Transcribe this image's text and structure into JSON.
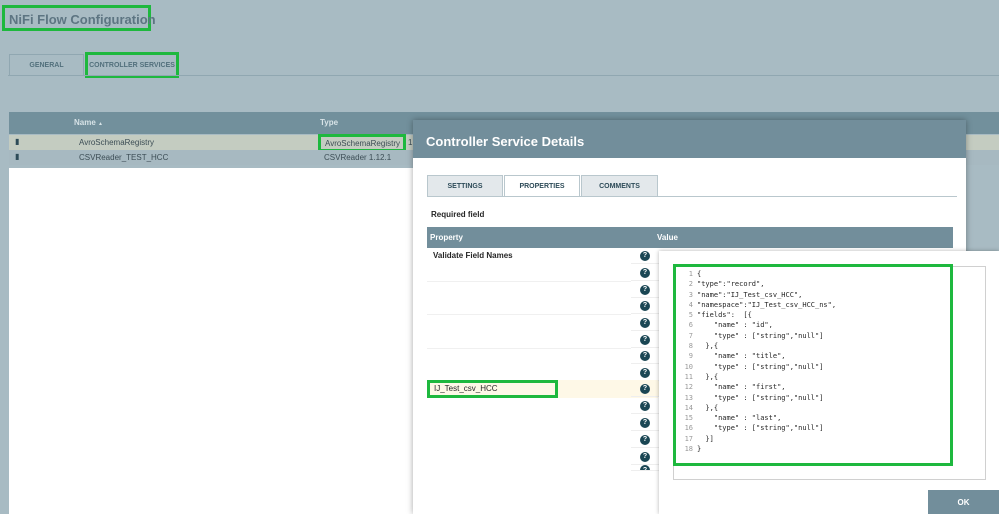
{
  "page": {
    "title": "NiFi Flow Configuration"
  },
  "tabs": {
    "general": "GENERAL",
    "controller_services": "CONTROLLER SERVICES"
  },
  "table": {
    "headers": {
      "name": "Name",
      "sort_indicator": "▲",
      "type": "Type"
    },
    "rows": [
      {
        "name": "AvroSchemaRegistry",
        "type": "AvroSchemaRegistry",
        "type_extra": "1"
      },
      {
        "name": "CSVReader_TEST_HCC",
        "type": "CSVReader 1.12.1"
      }
    ]
  },
  "dialog": {
    "title": "Controller Service Details",
    "tabs": {
      "settings": "SETTINGS",
      "properties": "PROPERTIES",
      "comments": "COMMENTS"
    },
    "required_label": "Required field",
    "columns": {
      "property": "Property",
      "value": "Value"
    },
    "properties": [
      {
        "name": "Validate Field Names"
      },
      {
        "name": "IJ_Test_csv_HCC"
      }
    ],
    "help_glyph": "?",
    "ok_label": "OK"
  },
  "editor": {
    "line_numbers": "1\n2\n3\n4\n5\n6\n7\n8\n9\n10\n11\n12\n13\n14\n15\n16\n17\n18",
    "code": "{\n\"type\":\"record\",\n\"name\":\"IJ_Test_csv_HCC\",\n\"namespace\":\"IJ_Test_csv_HCC_ns\",\n\"fields\":  [{\n    \"name\" : \"id\",\n    \"type\" : [\"string\",\"null\"]\n  },{\n    \"name\" : \"title\",\n    \"type\" : [\"string\",\"null\"]\n  },{\n    \"name\" : \"first\",\n    \"type\" : [\"string\",\"null\"]\n  },{\n    \"name\" : \"last\",\n    \"type\" : [\"string\",\"null\"]\n  }]\n}"
  },
  "colors": {
    "highlight": "#1eb83e",
    "header": "#728e9b",
    "background": "#a8bbc3"
  },
  "icons": {
    "row_icon": "book-icon",
    "help_icon": "question-circle-icon"
  }
}
